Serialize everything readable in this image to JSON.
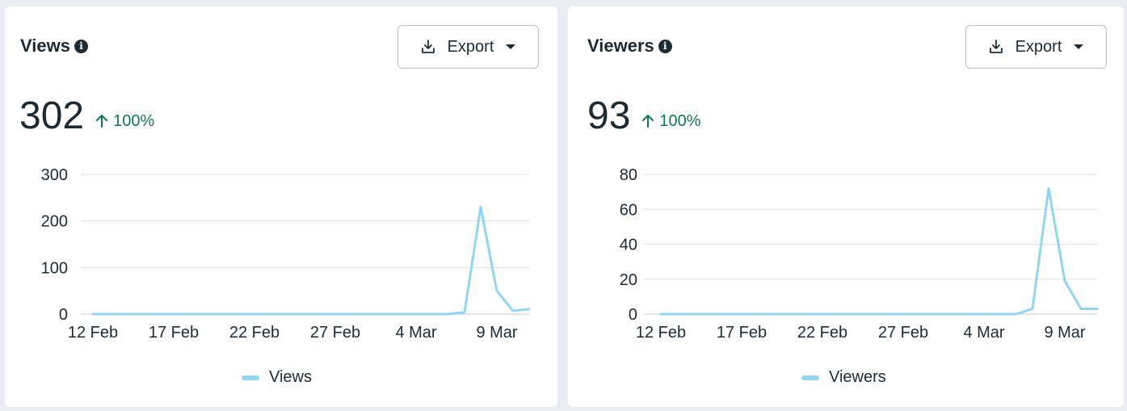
{
  "colors": {
    "line": "#8fd5f4",
    "grid": "#dcdfe3",
    "positive": "#0a7a55"
  },
  "cards": [
    {
      "title": "Views",
      "total": "302",
      "delta": "100%",
      "export_label": "Export",
      "legend": "Views"
    },
    {
      "title": "Viewers",
      "total": "93",
      "delta": "100%",
      "export_label": "Export",
      "legend": "Viewers"
    }
  ],
  "chart_data": [
    {
      "type": "line",
      "x_ticks": [
        "12 Feb",
        "17 Feb",
        "22 Feb",
        "27 Feb",
        "4 Mar",
        "9 Mar"
      ],
      "x": [
        "12 Feb",
        "13 Feb",
        "14 Feb",
        "15 Feb",
        "16 Feb",
        "17 Feb",
        "18 Feb",
        "19 Feb",
        "20 Feb",
        "21 Feb",
        "22 Feb",
        "23 Feb",
        "24 Feb",
        "25 Feb",
        "26 Feb",
        "27 Feb",
        "28 Feb",
        "1 Mar",
        "2 Mar",
        "3 Mar",
        "4 Mar",
        "5 Mar",
        "6 Mar",
        "7 Mar",
        "8 Mar",
        "9 Mar",
        "10 Mar",
        "11 Mar"
      ],
      "series": [
        {
          "name": "Views",
          "values": [
            0,
            0,
            0,
            0,
            0,
            0,
            0,
            0,
            0,
            0,
            0,
            0,
            0,
            0,
            0,
            0,
            0,
            0,
            0,
            0,
            0,
            0,
            0,
            4,
            230,
            50,
            7,
            11
          ]
        }
      ],
      "ylim": [
        0,
        300
      ],
      "y_ticks": [
        "0",
        "100",
        "200",
        "300"
      ],
      "grid": true,
      "legend_position": "bottom"
    },
    {
      "type": "line",
      "x_ticks": [
        "12 Feb",
        "17 Feb",
        "22 Feb",
        "27 Feb",
        "4 Mar",
        "9 Mar"
      ],
      "x": [
        "12 Feb",
        "13 Feb",
        "14 Feb",
        "15 Feb",
        "16 Feb",
        "17 Feb",
        "18 Feb",
        "19 Feb",
        "20 Feb",
        "21 Feb",
        "22 Feb",
        "23 Feb",
        "24 Feb",
        "25 Feb",
        "26 Feb",
        "27 Feb",
        "28 Feb",
        "1 Mar",
        "2 Mar",
        "3 Mar",
        "4 Mar",
        "5 Mar",
        "6 Mar",
        "7 Mar",
        "8 Mar",
        "9 Mar",
        "10 Mar",
        "11 Mar"
      ],
      "series": [
        {
          "name": "Viewers",
          "values": [
            0,
            0,
            0,
            0,
            0,
            0,
            0,
            0,
            0,
            0,
            0,
            0,
            0,
            0,
            0,
            0,
            0,
            0,
            0,
            0,
            0,
            0,
            0,
            3,
            72,
            19,
            3,
            3
          ]
        }
      ],
      "ylim": [
        0,
        80
      ],
      "y_ticks": [
        "0",
        "20",
        "40",
        "60",
        "80"
      ],
      "grid": true,
      "legend_position": "bottom"
    }
  ]
}
